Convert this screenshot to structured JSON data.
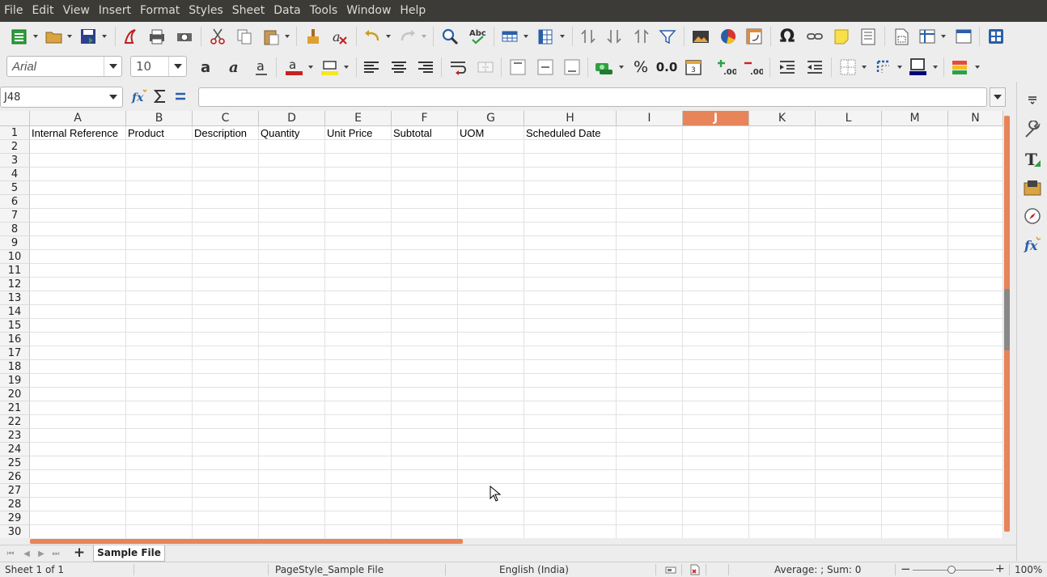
{
  "menu": [
    "File",
    "Edit",
    "View",
    "Insert",
    "Format",
    "Styles",
    "Sheet",
    "Data",
    "Tools",
    "Window",
    "Help"
  ],
  "toolbar": {
    "font_name": "Arial",
    "font_size": "10",
    "percent_label": "%",
    "number_label": "0.0",
    "omega_label": "Ω"
  },
  "formula_bar": {
    "name_box": "J48",
    "formula": ""
  },
  "sheet": {
    "columns": [
      "A",
      "B",
      "C",
      "D",
      "E",
      "F",
      "G",
      "H",
      "I",
      "J",
      "K",
      "L",
      "M",
      "N"
    ],
    "selected_column": "J",
    "rows": [
      "1",
      "2",
      "3",
      "4",
      "5",
      "6",
      "7",
      "8",
      "9",
      "10",
      "11",
      "12",
      "13",
      "14",
      "15",
      "16",
      "17",
      "18",
      "19",
      "20",
      "21",
      "22",
      "23",
      "24",
      "25",
      "26",
      "27",
      "28",
      "29",
      "30"
    ],
    "header_row": [
      "Internal Reference",
      "Product",
      "Description",
      "Quantity",
      "Unit Price",
      "Subtotal",
      "UOM",
      "Scheduled Date"
    ]
  },
  "tabs": {
    "add_label": "+",
    "sheet_name": "Sample File"
  },
  "status": {
    "sheet_info": "Sheet 1 of 1",
    "page_style": "PageStyle_Sample File",
    "language": "English (India)",
    "summary": "Average: ; Sum: 0",
    "zoom": "100%",
    "zoom_minus": "−",
    "zoom_plus": "+"
  },
  "colors": {
    "accent": "#e8845a",
    "menubar_bg": "#3c3b37"
  }
}
